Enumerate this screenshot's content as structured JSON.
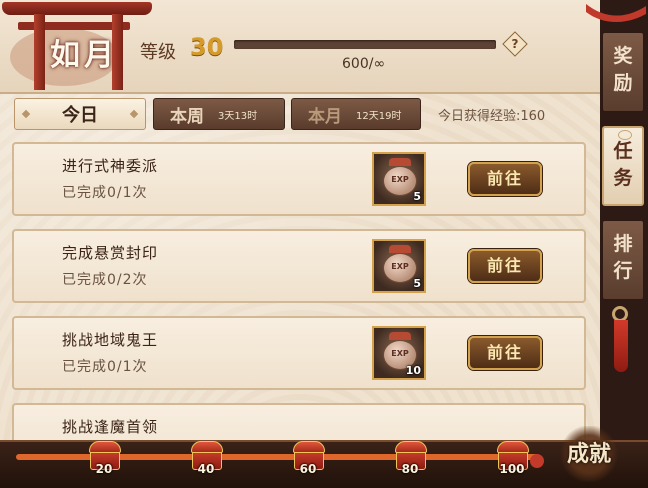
{
  "header": {
    "player_name": "如月",
    "level_label": "等级",
    "level_value": "30",
    "exp_text": "600/∞",
    "exp_fill_fraction": 0,
    "help_icon_glyph": "?"
  },
  "tabs": {
    "today_label": "今日",
    "week_label": "本周",
    "week_timer": "3天13时",
    "month_label": "本月",
    "month_timer": "12天19时",
    "today_exp": "今日获得经验:160"
  },
  "tasks": [
    {
      "title": "进行式神委派",
      "progress": "已完成0/1次",
      "reward_icon": "exp-bag-icon",
      "reward_text": "EXP",
      "reward_count": "5",
      "button_label": "前往"
    },
    {
      "title": "完成悬赏封印",
      "progress": "已完成0/2次",
      "reward_icon": "exp-bag-icon",
      "reward_text": "EXP",
      "reward_count": "5",
      "button_label": "前往"
    },
    {
      "title": "挑战地域鬼王",
      "progress": "已完成0/1次",
      "reward_icon": "exp-bag-icon",
      "reward_text": "EXP",
      "reward_count": "10",
      "button_label": "前往"
    },
    {
      "title": "挑战逢魔首领",
      "progress": "",
      "reward_icon": "exp-bag-icon",
      "reward_text": "",
      "reward_count": "",
      "button_label": ""
    }
  ],
  "side_tabs": [
    {
      "label_1": "奖",
      "label_2": "励",
      "active": false
    },
    {
      "label_1": "任",
      "label_2": "务",
      "active": true
    },
    {
      "label_1": "排",
      "label_2": "行",
      "active": false
    }
  ],
  "bottom": {
    "progress_fraction": 1,
    "milestones": [
      "20",
      "40",
      "60",
      "80",
      "100"
    ],
    "achievement_label": "成就"
  },
  "colors": {
    "accent_gold": "#d59b2a",
    "progress_orange": "#e0672c",
    "dark_brown": "#5a3c2c"
  }
}
